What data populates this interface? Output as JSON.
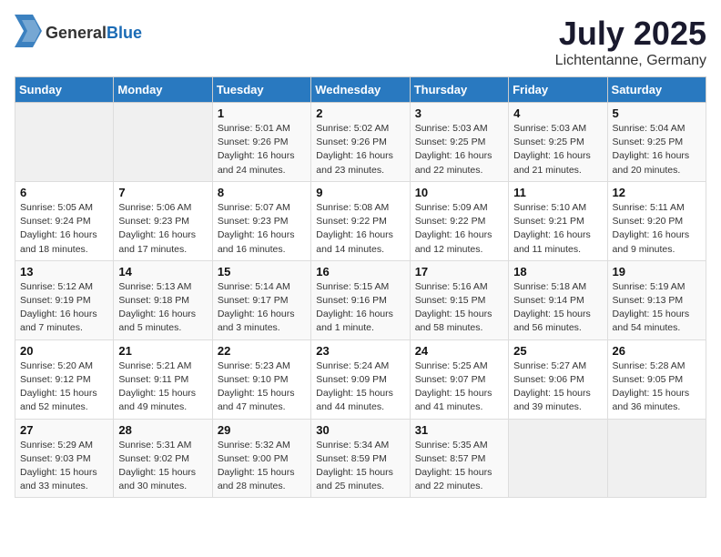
{
  "header": {
    "logo_general": "General",
    "logo_blue": "Blue",
    "month": "July 2025",
    "location": "Lichtentanne, Germany"
  },
  "weekdays": [
    "Sunday",
    "Monday",
    "Tuesday",
    "Wednesday",
    "Thursday",
    "Friday",
    "Saturday"
  ],
  "weeks": [
    [
      {
        "day": "",
        "empty": true
      },
      {
        "day": "",
        "empty": true
      },
      {
        "day": "1",
        "sunrise": "Sunrise: 5:01 AM",
        "sunset": "Sunset: 9:26 PM",
        "daylight": "Daylight: 16 hours and 24 minutes."
      },
      {
        "day": "2",
        "sunrise": "Sunrise: 5:02 AM",
        "sunset": "Sunset: 9:26 PM",
        "daylight": "Daylight: 16 hours and 23 minutes."
      },
      {
        "day": "3",
        "sunrise": "Sunrise: 5:03 AM",
        "sunset": "Sunset: 9:25 PM",
        "daylight": "Daylight: 16 hours and 22 minutes."
      },
      {
        "day": "4",
        "sunrise": "Sunrise: 5:03 AM",
        "sunset": "Sunset: 9:25 PM",
        "daylight": "Daylight: 16 hours and 21 minutes."
      },
      {
        "day": "5",
        "sunrise": "Sunrise: 5:04 AM",
        "sunset": "Sunset: 9:25 PM",
        "daylight": "Daylight: 16 hours and 20 minutes."
      }
    ],
    [
      {
        "day": "6",
        "sunrise": "Sunrise: 5:05 AM",
        "sunset": "Sunset: 9:24 PM",
        "daylight": "Daylight: 16 hours and 18 minutes."
      },
      {
        "day": "7",
        "sunrise": "Sunrise: 5:06 AM",
        "sunset": "Sunset: 9:23 PM",
        "daylight": "Daylight: 16 hours and 17 minutes."
      },
      {
        "day": "8",
        "sunrise": "Sunrise: 5:07 AM",
        "sunset": "Sunset: 9:23 PM",
        "daylight": "Daylight: 16 hours and 16 minutes."
      },
      {
        "day": "9",
        "sunrise": "Sunrise: 5:08 AM",
        "sunset": "Sunset: 9:22 PM",
        "daylight": "Daylight: 16 hours and 14 minutes."
      },
      {
        "day": "10",
        "sunrise": "Sunrise: 5:09 AM",
        "sunset": "Sunset: 9:22 PM",
        "daylight": "Daylight: 16 hours and 12 minutes."
      },
      {
        "day": "11",
        "sunrise": "Sunrise: 5:10 AM",
        "sunset": "Sunset: 9:21 PM",
        "daylight": "Daylight: 16 hours and 11 minutes."
      },
      {
        "day": "12",
        "sunrise": "Sunrise: 5:11 AM",
        "sunset": "Sunset: 9:20 PM",
        "daylight": "Daylight: 16 hours and 9 minutes."
      }
    ],
    [
      {
        "day": "13",
        "sunrise": "Sunrise: 5:12 AM",
        "sunset": "Sunset: 9:19 PM",
        "daylight": "Daylight: 16 hours and 7 minutes."
      },
      {
        "day": "14",
        "sunrise": "Sunrise: 5:13 AM",
        "sunset": "Sunset: 9:18 PM",
        "daylight": "Daylight: 16 hours and 5 minutes."
      },
      {
        "day": "15",
        "sunrise": "Sunrise: 5:14 AM",
        "sunset": "Sunset: 9:17 PM",
        "daylight": "Daylight: 16 hours and 3 minutes."
      },
      {
        "day": "16",
        "sunrise": "Sunrise: 5:15 AM",
        "sunset": "Sunset: 9:16 PM",
        "daylight": "Daylight: 16 hours and 1 minute."
      },
      {
        "day": "17",
        "sunrise": "Sunrise: 5:16 AM",
        "sunset": "Sunset: 9:15 PM",
        "daylight": "Daylight: 15 hours and 58 minutes."
      },
      {
        "day": "18",
        "sunrise": "Sunrise: 5:18 AM",
        "sunset": "Sunset: 9:14 PM",
        "daylight": "Daylight: 15 hours and 56 minutes."
      },
      {
        "day": "19",
        "sunrise": "Sunrise: 5:19 AM",
        "sunset": "Sunset: 9:13 PM",
        "daylight": "Daylight: 15 hours and 54 minutes."
      }
    ],
    [
      {
        "day": "20",
        "sunrise": "Sunrise: 5:20 AM",
        "sunset": "Sunset: 9:12 PM",
        "daylight": "Daylight: 15 hours and 52 minutes."
      },
      {
        "day": "21",
        "sunrise": "Sunrise: 5:21 AM",
        "sunset": "Sunset: 9:11 PM",
        "daylight": "Daylight: 15 hours and 49 minutes."
      },
      {
        "day": "22",
        "sunrise": "Sunrise: 5:23 AM",
        "sunset": "Sunset: 9:10 PM",
        "daylight": "Daylight: 15 hours and 47 minutes."
      },
      {
        "day": "23",
        "sunrise": "Sunrise: 5:24 AM",
        "sunset": "Sunset: 9:09 PM",
        "daylight": "Daylight: 15 hours and 44 minutes."
      },
      {
        "day": "24",
        "sunrise": "Sunrise: 5:25 AM",
        "sunset": "Sunset: 9:07 PM",
        "daylight": "Daylight: 15 hours and 41 minutes."
      },
      {
        "day": "25",
        "sunrise": "Sunrise: 5:27 AM",
        "sunset": "Sunset: 9:06 PM",
        "daylight": "Daylight: 15 hours and 39 minutes."
      },
      {
        "day": "26",
        "sunrise": "Sunrise: 5:28 AM",
        "sunset": "Sunset: 9:05 PM",
        "daylight": "Daylight: 15 hours and 36 minutes."
      }
    ],
    [
      {
        "day": "27",
        "sunrise": "Sunrise: 5:29 AM",
        "sunset": "Sunset: 9:03 PM",
        "daylight": "Daylight: 15 hours and 33 minutes."
      },
      {
        "day": "28",
        "sunrise": "Sunrise: 5:31 AM",
        "sunset": "Sunset: 9:02 PM",
        "daylight": "Daylight: 15 hours and 30 minutes."
      },
      {
        "day": "29",
        "sunrise": "Sunrise: 5:32 AM",
        "sunset": "Sunset: 9:00 PM",
        "daylight": "Daylight: 15 hours and 28 minutes."
      },
      {
        "day": "30",
        "sunrise": "Sunrise: 5:34 AM",
        "sunset": "Sunset: 8:59 PM",
        "daylight": "Daylight: 15 hours and 25 minutes."
      },
      {
        "day": "31",
        "sunrise": "Sunrise: 5:35 AM",
        "sunset": "Sunset: 8:57 PM",
        "daylight": "Daylight: 15 hours and 22 minutes."
      },
      {
        "day": "",
        "empty": true
      },
      {
        "day": "",
        "empty": true
      }
    ]
  ]
}
